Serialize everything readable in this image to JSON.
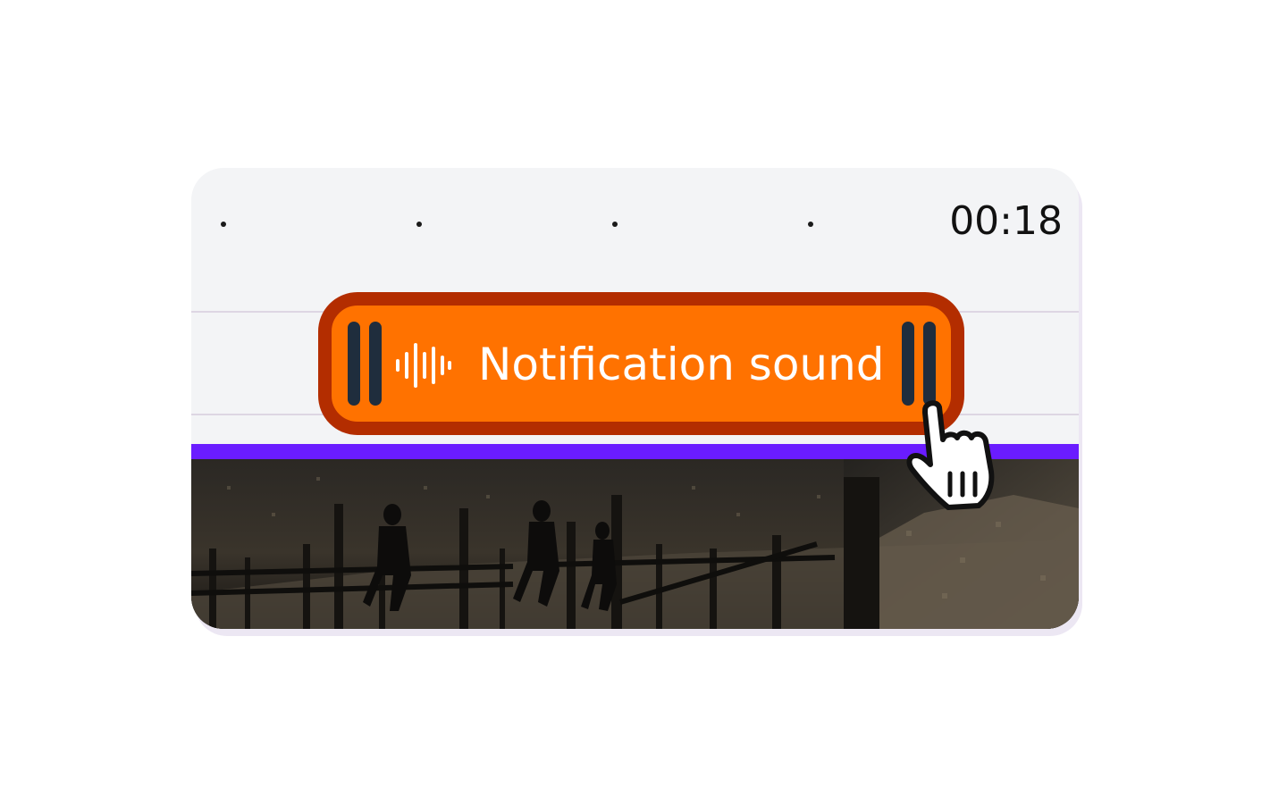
{
  "timeline": {
    "timecode": "00:18",
    "ruler_ticks": 4
  },
  "audio_clip": {
    "label": "Notification sound",
    "icon": "sound-wave-icon",
    "fill_color": "#ff7200",
    "border_color": "#b32d00"
  },
  "playhead": {
    "color": "#6a1cff"
  },
  "cursor": {
    "icon": "hand-pointer-icon"
  }
}
